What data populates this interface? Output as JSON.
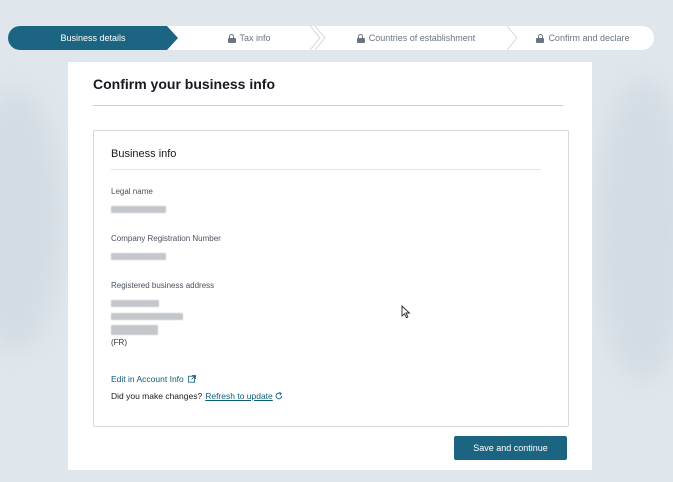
{
  "stepper": {
    "steps": [
      {
        "label": "Business details",
        "state": "active"
      },
      {
        "label": "Tax info",
        "state": "locked"
      },
      {
        "label": "Countries of establishment",
        "state": "locked"
      },
      {
        "label": "Confirm and declare",
        "state": "locked"
      }
    ]
  },
  "page": {
    "title": "Confirm your business info"
  },
  "business_info": {
    "section_title": "Business info",
    "legal_name_label": "Legal name",
    "registration_label": "Company Registration Number",
    "address_label": "Registered business address",
    "address_country": "(FR)"
  },
  "links": {
    "edit_account": "Edit in Account Info",
    "changes_prompt": "Did you make changes?",
    "refresh": "Refresh to update"
  },
  "actions": {
    "save_continue": "Save and continue"
  },
  "colors": {
    "accent": "#1c6582",
    "link": "#0f5c7a",
    "background": "#dfe6ec"
  }
}
